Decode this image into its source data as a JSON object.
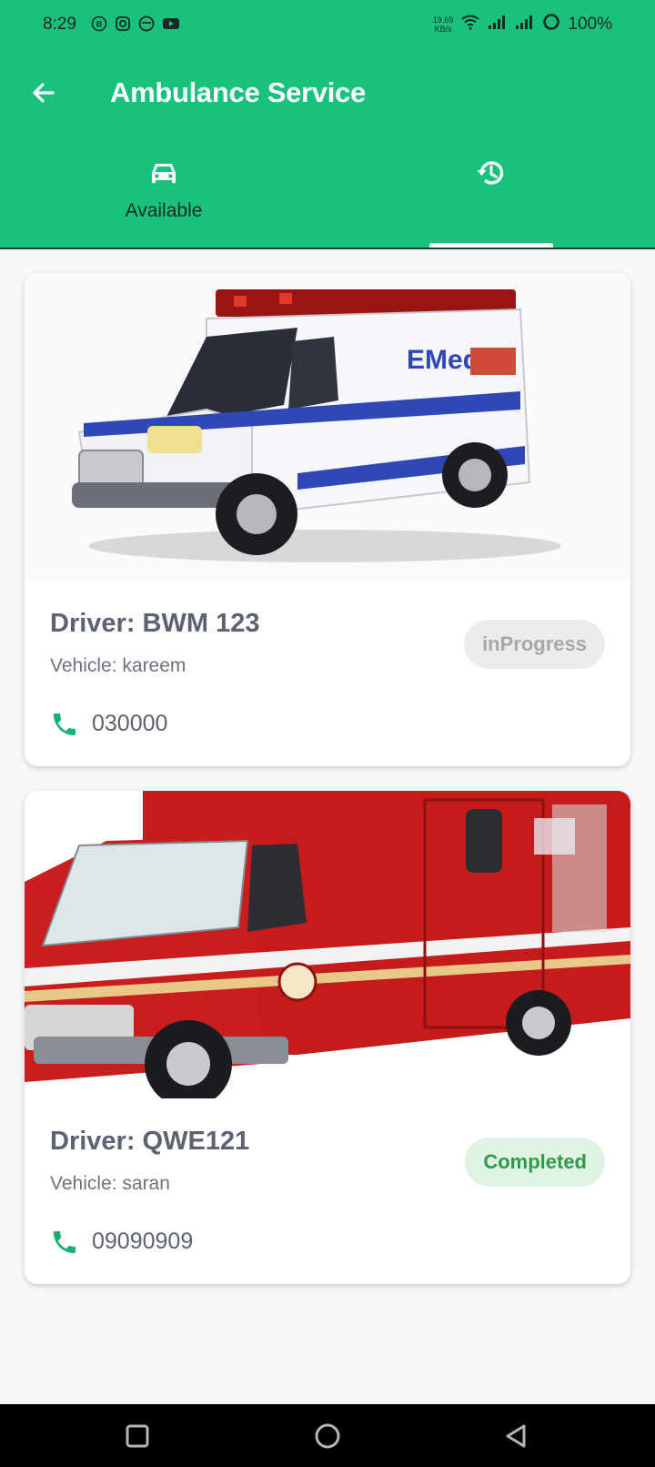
{
  "status_bar": {
    "time": "8:29",
    "net_speed_value": "19.69",
    "net_speed_unit": "KB/s",
    "battery": "100%"
  },
  "header": {
    "title": "Ambulance Service"
  },
  "tabs": [
    {
      "label": "Available",
      "icon": "ambulance-car-icon",
      "selected": false
    },
    {
      "label": "",
      "icon": "history-icon",
      "selected": true
    }
  ],
  "bookings": [
    {
      "driver": "Driver: BWM 123",
      "vehicle": "Vehicle: kareem",
      "phone": "030000",
      "status": "inProgress",
      "image": "white-ambulance-photo"
    },
    {
      "driver": "Driver: QWE121",
      "vehicle": "Vehicle: saran",
      "phone": "09090909",
      "status": "Completed",
      "image": "red-ambulance-photo"
    }
  ],
  "colors": {
    "primary": "#19c27c",
    "badge_progress_bg": "#ececec",
    "badge_completed_bg": "#dff3e4",
    "badge_completed_text": "#2e9b4a"
  }
}
